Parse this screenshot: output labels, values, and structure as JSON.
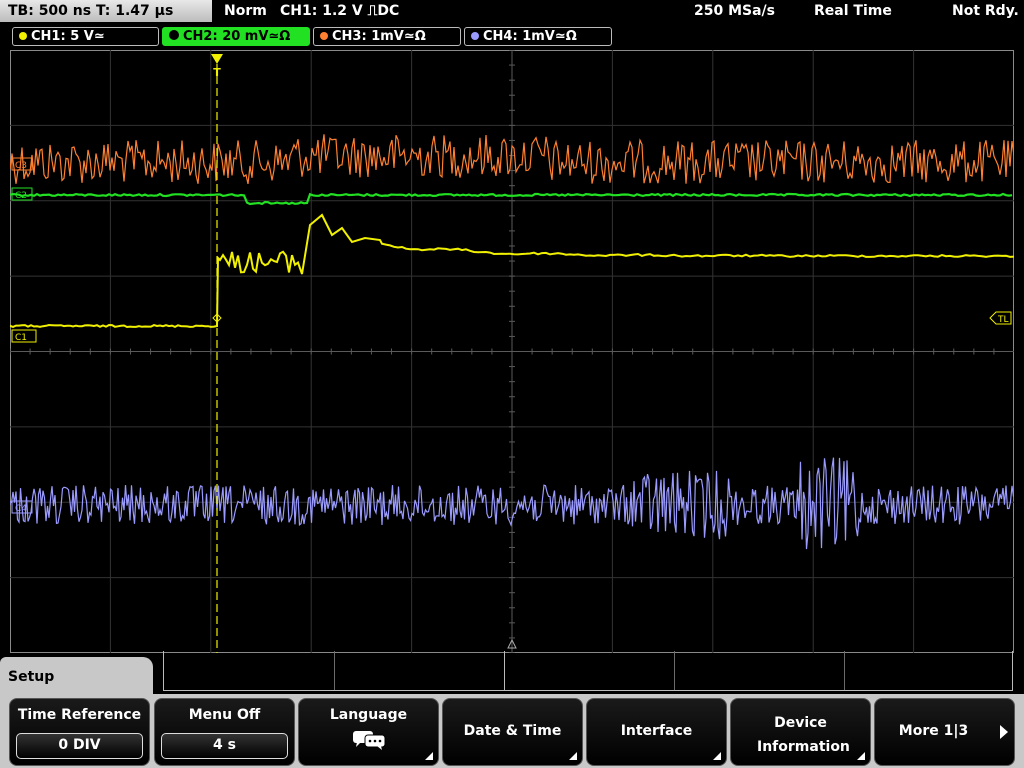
{
  "status": {
    "timebase": "TB: 500 ns   T: 1.47 µs",
    "mode": "Norm",
    "trigger": "CH1: 1.2 V ⎍DC",
    "sample_rate": "250 MSa/s",
    "acq_mode": "Real Time",
    "state": "Not Rdy."
  },
  "channels": [
    {
      "label": "CH1: 5 V≃",
      "color": "#f0f000"
    },
    {
      "label": "CH2: 20 mV≃Ω",
      "color": "#22e022"
    },
    {
      "label": "CH3: 1mV≃Ω",
      "color": "#ff8030"
    },
    {
      "label": "CH4: 1mV≃Ω",
      "color": "#9a9aff"
    }
  ],
  "markers": {
    "c2": "C2",
    "c3": "C3",
    "c1": "C1",
    "c4": "C4",
    "trigger_level": "TL",
    "trigger_pos": "T"
  },
  "menu": {
    "title": "Setup",
    "keys": [
      {
        "label": "Time Reference",
        "value": "0 DIV"
      },
      {
        "label": "Menu Off",
        "value": "4 s"
      },
      {
        "label": "Language",
        "icon": "speech-bubbles-icon"
      },
      {
        "label": "Date & Time"
      },
      {
        "label": "Interface"
      },
      {
        "label": "Device Information"
      },
      {
        "label": "More 1|3"
      }
    ]
  }
}
